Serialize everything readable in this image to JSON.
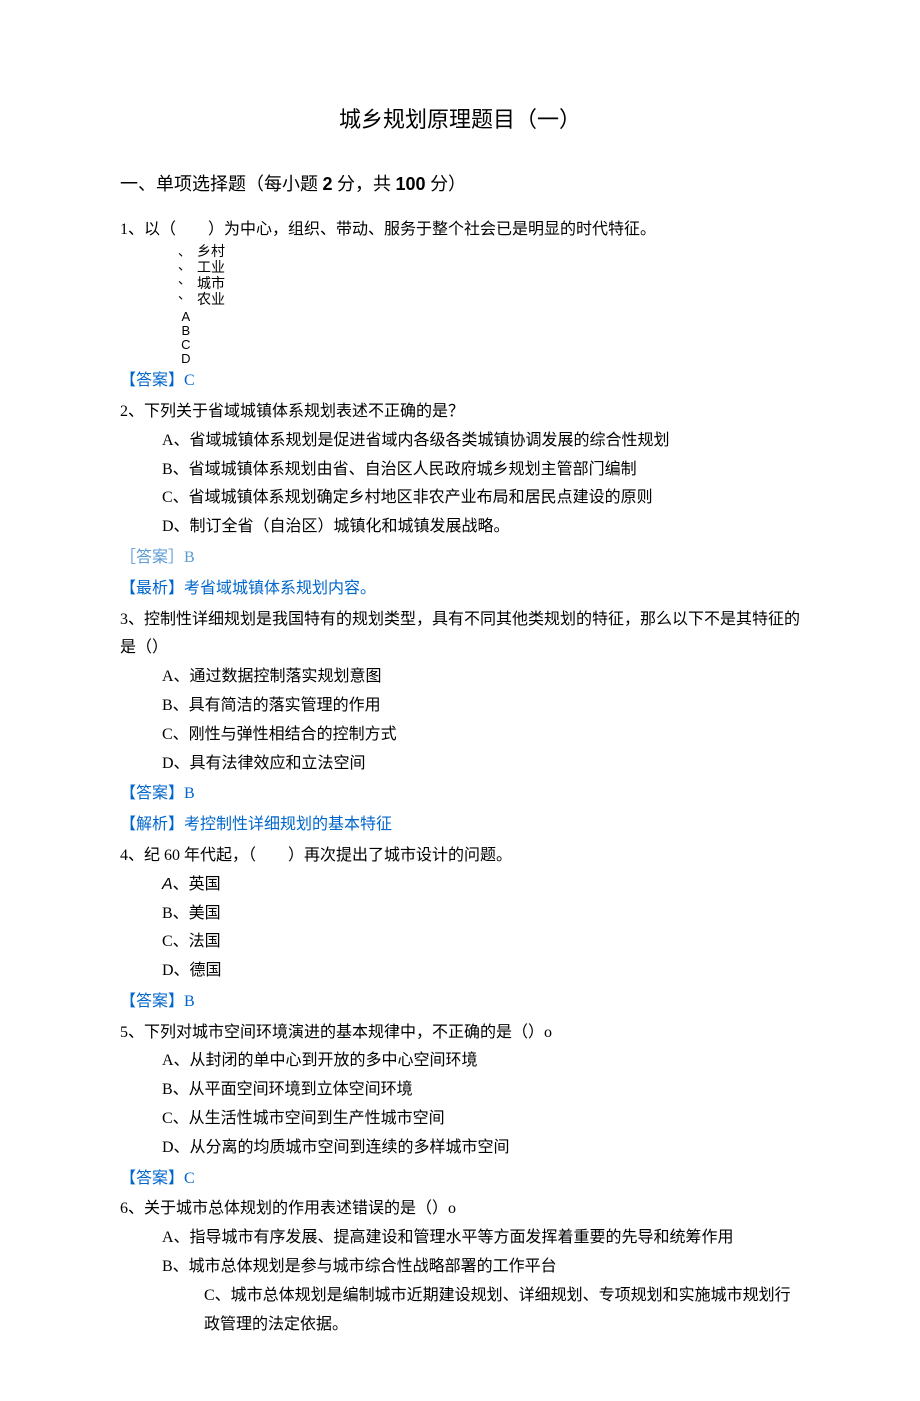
{
  "title": "城乡规划原理题目（一）",
  "section": {
    "label_pre": "一、单项选择题（每小题 ",
    "points_each": "2",
    "label_mid": " 分，共 ",
    "points_total": "100",
    "label_post": " 分）"
  },
  "q1": {
    "text_pre": "1、以（　　）为中心，组织、带动、服务于整个社会已是明显的时代特征。",
    "opts": {
      "a": "乡村",
      "b": "工业",
      "c": "城市",
      "d": "农业"
    },
    "letters": "ABCD",
    "marks": [
      "、",
      "、",
      "、",
      "、"
    ],
    "answer": "【答案】C"
  },
  "q2": {
    "text": "2、下列关于省域城镇体系规划表述不正确的是？",
    "opts": {
      "a": "A、省域城镇体系规划是促进省域内各级各类城镇协调发展的综合性规划",
      "b": "B、省域城镇体系规划由省、自治区人民政府城乡规划主管部门编制",
      "c": "C、省域城镇体系规划确定乡村地区非农产业布局和居民点建设的原则",
      "d": "D、制订全省（自治区）城镇化和城镇发展战略。"
    },
    "answer": "［答案］B",
    "analysis": "【最析】考省域城镇体系规划内容。"
  },
  "q3": {
    "text": "3、控制性详细规划是我国特有的规划类型，具有不同其他类规划的特征，那么以下不是其特征的是（）",
    "opts": {
      "a": "A、通过数据控制落实规划意图",
      "b": "B、具有简洁的落实管理的作用",
      "c": "C、刚性与弹性相结合的控制方式",
      "d": "D、具有法律效应和立法空间"
    },
    "answer": "【答案】B",
    "analysis": "【解析】考控制性详细规划的基本特征"
  },
  "q4": {
    "text": "4、纪 60 年代起，（　　）再次提出了城市设计的问题。",
    "opts": {
      "a_letter": "A",
      "a_text": "、英国",
      "b": "B、美国",
      "c": "C、法国",
      "d": "D、德国"
    },
    "answer": "【答案】B"
  },
  "q5": {
    "text": "5、下列对城市空间环境演进的基本规律中，不正确的是（）o",
    "opts": {
      "a": "A、从封闭的单中心到开放的多中心空间环境",
      "b": "B、从平面空间环境到立体空间环境",
      "c": "C、从生活性城市空间到生产性城市空间",
      "d": "D、从分离的均质城市空间到连续的多样城市空间"
    },
    "answer": "【答案】C"
  },
  "q6": {
    "text": "6、关于城市总体规划的作用表述错误的是（）o",
    "opts": {
      "a": "A、指导城市有序发展、提高建设和管理水平等方面发挥着重要的先导和统筹作用",
      "b": "B、城市总体规划是参与城市综合性战略部署的工作平台",
      "c": "C、城市总体规划是编制城市近期建设规划、详细规划、专项规划和实施城市规划行政管理的法定依据。"
    }
  }
}
